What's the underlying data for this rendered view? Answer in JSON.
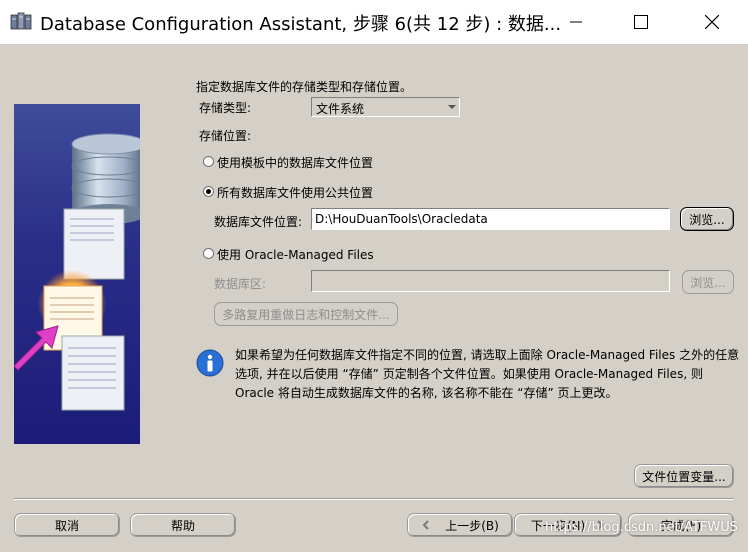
{
  "window": {
    "title": "Database Configuration Assistant, 步骤 6(共 12 步) : 数据...",
    "minimize_icon": "minimize-icon",
    "maximize_icon": "maximize-icon",
    "close_icon": "close-icon"
  },
  "form": {
    "heading": "指定数据库文件的存储类型和存储位置。",
    "storage_type_label": "存储类型:",
    "storage_type_value": "文件系统",
    "storage_location_label": "存储位置:",
    "options": [
      {
        "label": "使用模板中的数据库文件位置",
        "selected": false
      },
      {
        "label": "所有数据库文件使用公共位置",
        "selected": true
      },
      {
        "label": "使用 Oracle-Managed Files",
        "selected": false
      }
    ],
    "db_file_location_label": "数据库文件位置:",
    "db_file_location_value": "D:\\HouDuanTools\\Oracledata",
    "browse_label": "浏览...",
    "db_area_label": "数据库区:",
    "db_area_value": "",
    "browse_disabled_label": "浏览...",
    "multiplex_label": "多路复用重做日志和控制文件..."
  },
  "info": {
    "icon": "info-icon",
    "lines": [
      "如果希望为任何数据库文件指定不同的位置, 请选取上面除 Oracle-Managed Files 之外的任意",
      "选项, 并在以后使用 “存储” 页定制各个文件位置。如果使用 Oracle-Managed Files, 则",
      "Oracle 将自动生成数据库文件的名称, 该名称不能在 “存储” 页上更改。"
    ]
  },
  "file_location_vars_label": "文件位置变量...",
  "footer": {
    "cancel": "取消",
    "help": "帮助",
    "back": "上一步(B)",
    "next": "下一步(N)",
    "finish": "完成(F)"
  },
  "watermark": "https://blog.csdn.net/ATFWUS"
}
